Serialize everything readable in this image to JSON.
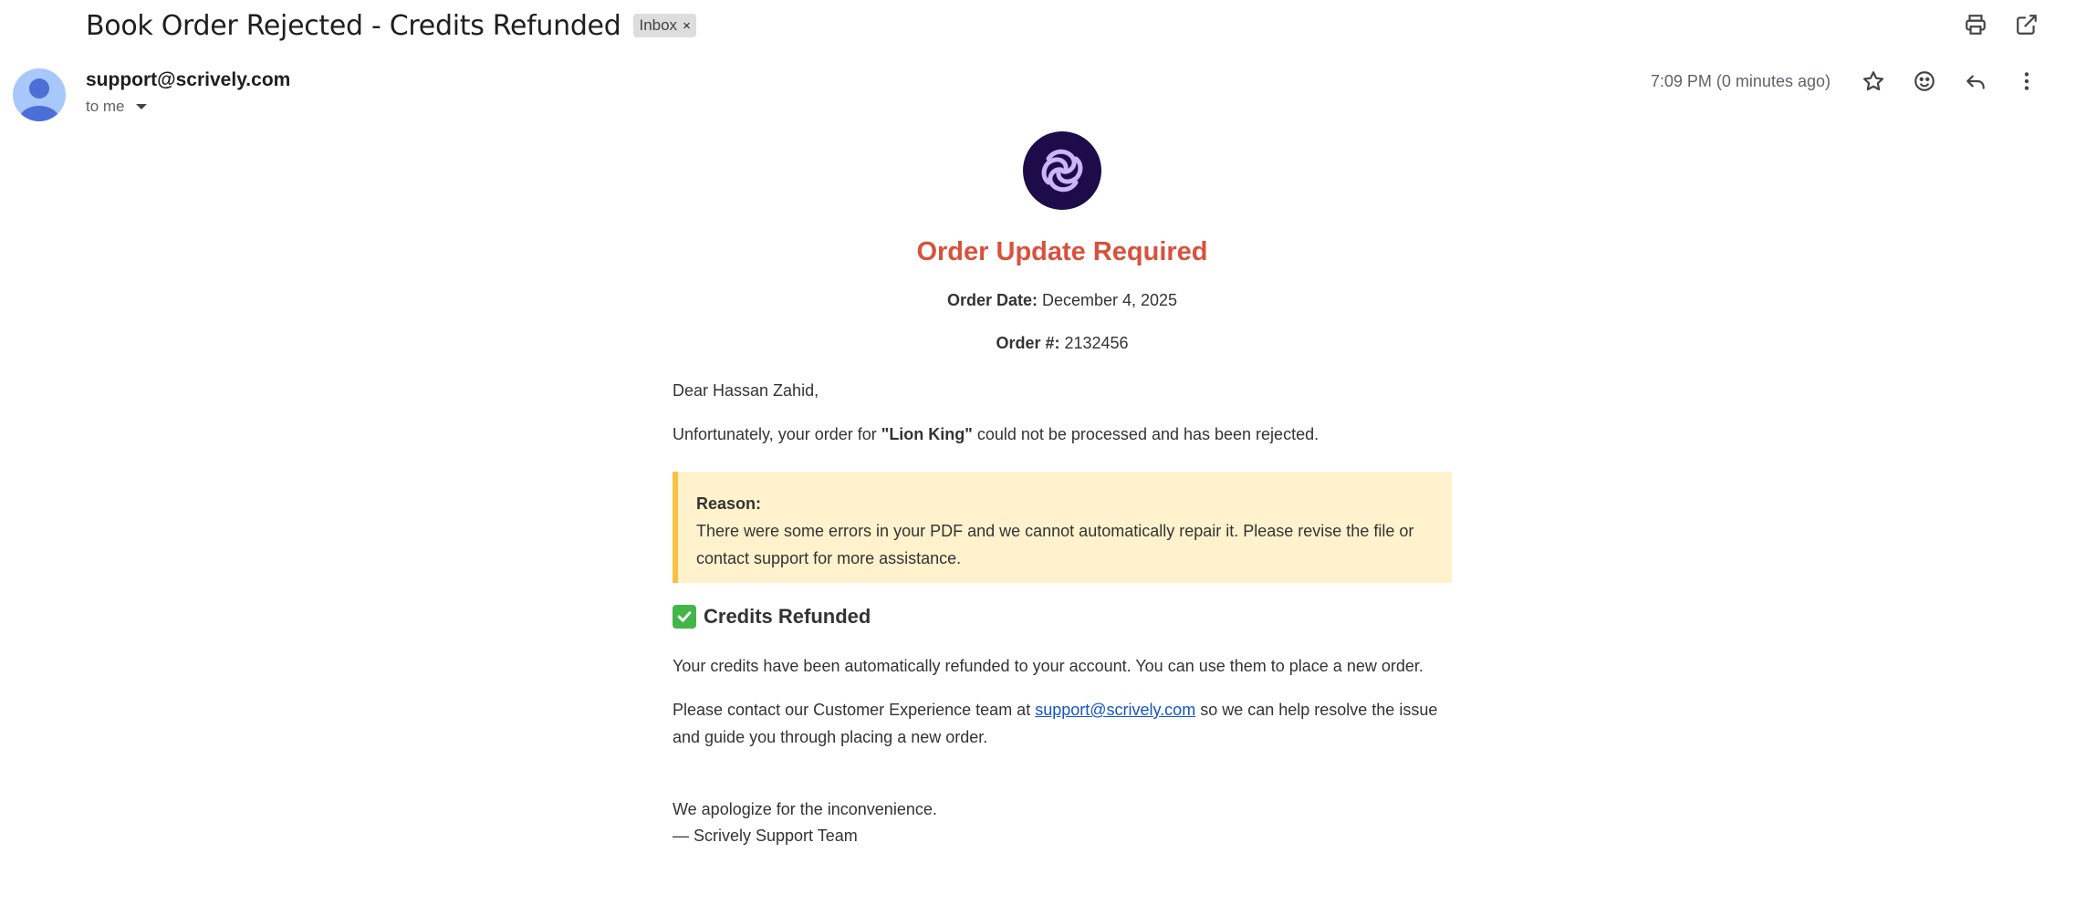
{
  "header": {
    "subject": "Book Order Rejected - Credits Refunded",
    "label": "Inbox",
    "label_close": "×",
    "icons": [
      "print-icon",
      "open-in-new-window-icon"
    ]
  },
  "message_meta": {
    "sender": "support@scrively.com",
    "to": "to me",
    "time": "7:09 PM (0 minutes ago)",
    "action_icons": [
      "star-icon",
      "emoji-icon",
      "reply-icon",
      "more-vert-icon"
    ]
  },
  "email": {
    "title": "Order Update Required",
    "order_date_label": "Order Date:",
    "order_date_value": " December 4, 2025",
    "order_num_label": "Order #:",
    "order_num_value": " 2132456",
    "greeting": "Dear Hassan Zahid,",
    "rejection_pre": "Unfortunately, your order for ",
    "book_title": "\"Lion King\"",
    "rejection_post": " could not be processed and has been rejected.",
    "reason_label": "Reason:",
    "reason_text": "There were some errors in your PDF and we cannot automatically repair it. Please revise the file or contact support for more assistance.",
    "credits_heading": "Credits Refunded",
    "credits_text": "Your credits have been automatically refunded to your account. You can use them to place a new order.",
    "contact_pre": "Please contact our Customer Experience team at ",
    "contact_link": "support@scrively.com",
    "contact_post": " so we can help resolve the issue and guide you through placing a new order.",
    "apology": "We apologize for the inconvenience.",
    "signature": "— Scrively Support Team"
  },
  "colors": {
    "title_red": "#d9513c",
    "reason_bg": "#fff2cc",
    "reason_border": "#f7c243",
    "link_blue": "#1155cc",
    "logo_bg": "#1e0b4a"
  }
}
